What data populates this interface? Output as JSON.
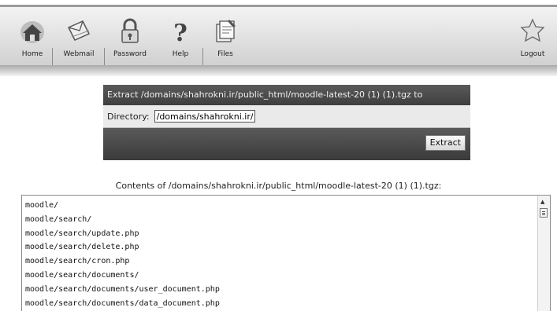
{
  "toolbar": {
    "home": "Home",
    "webmail": "Webmail",
    "password": "Password",
    "help": "Help",
    "files": "Files",
    "logout": "Logout"
  },
  "extract": {
    "title": "Extract /domains/shahrokni.ir/public_html/moodle-latest-20 (1) (1).tgz to",
    "directory_label": "Directory:",
    "directory_value": "/domains/shahrokni.ir/p",
    "button": "Extract"
  },
  "contents": {
    "title": "Contents of /domains/shahrokni.ir/public_html/moodle-latest-20 (1) (1).tgz:",
    "lines": [
      "moodle/",
      "moodle/search/",
      "moodle/search/update.php",
      "moodle/search/delete.php",
      "moodle/search/cron.php",
      "moodle/search/documents/",
      "moodle/search/documents/user_document.php",
      "moodle/search/documents/data_document.php"
    ]
  }
}
